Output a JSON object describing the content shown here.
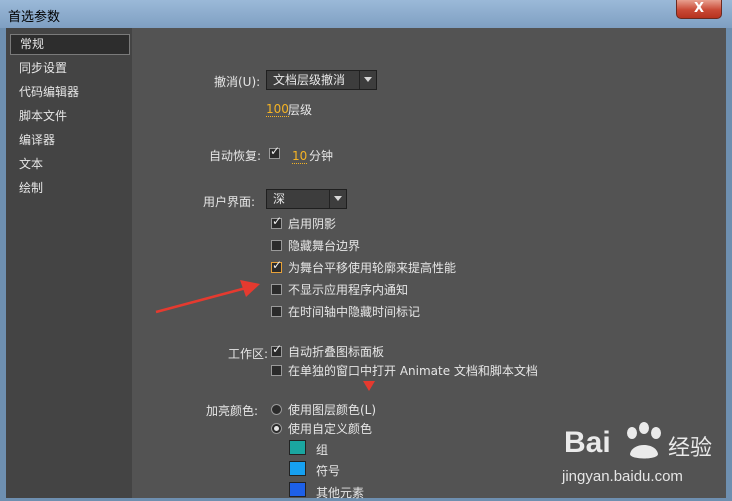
{
  "window": {
    "title": "首选参数",
    "close_glyph": "X"
  },
  "sidebar": {
    "items": [
      {
        "label": "常规",
        "active": true
      },
      {
        "label": "同步设置"
      },
      {
        "label": "代码编辑器"
      },
      {
        "label": "脚本文件"
      },
      {
        "label": "编译器"
      },
      {
        "label": "文本"
      },
      {
        "label": "绘制"
      }
    ]
  },
  "undo": {
    "label": "撤消(U):",
    "select_value": "文档层级撤消",
    "levels_value": "100",
    "levels_unit": "层级"
  },
  "autosave": {
    "label": "自动恢复:",
    "checked": true,
    "minutes_value": "10",
    "minutes_unit": "分钟"
  },
  "ui": {
    "label": "用户界面:",
    "select_value": "深",
    "options": [
      {
        "label": "启用阴影",
        "checked": true
      },
      {
        "label": "隐藏舞台边界",
        "checked": false
      },
      {
        "label": "为舞台平移使用轮廓来提高性能",
        "checked": true
      },
      {
        "label": "不显示应用程序内通知",
        "checked": false
      },
      {
        "label": "在时间轴中隐藏时间标记",
        "checked": false
      }
    ]
  },
  "workspace": {
    "label": "工作区:",
    "options": [
      {
        "label": "自动折叠图标面板",
        "checked": true
      },
      {
        "label": "在单独的窗口中打开 Animate 文档和脚本文档",
        "checked": false
      }
    ]
  },
  "highlight": {
    "label": "加亮颜色:",
    "radio_layer": "使用图层颜色(L)",
    "radio_custom": "使用自定义颜色",
    "selected": "custom",
    "swatches": [
      {
        "label": "组",
        "color": "#1aa6a0"
      },
      {
        "label": "符号",
        "color": "#16a0f0"
      },
      {
        "label": "其他元素",
        "color": "#1d60e8"
      }
    ]
  },
  "watermark": {
    "brand": "Bai",
    "brand_suffix": "经验",
    "url": "jingyan.baidu.com"
  },
  "colors": {
    "annotation_red": "#e53a2f",
    "accent_orange": "#f5b324"
  }
}
